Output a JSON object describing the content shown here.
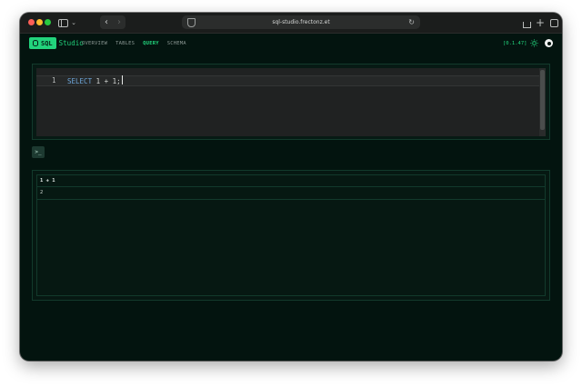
{
  "browser": {
    "url": "sql-studio.frectonz.et"
  },
  "app": {
    "logo_label": "SQL",
    "logo_word": "Studio",
    "nav": [
      {
        "label": "OVERVIEW",
        "active": false
      },
      {
        "label": "TABLES",
        "active": false
      },
      {
        "label": "QUERY",
        "active": true
      },
      {
        "label": "SCHEMA",
        "active": false
      }
    ],
    "version": "[0.1.47]",
    "accent_color": "#22d37c"
  },
  "editor": {
    "line_number": "1",
    "keyword": "SELECT",
    "rest": " 1 + 1;"
  },
  "run_button": {
    "label": ">_"
  },
  "results": {
    "columns": [
      "1 + 1"
    ],
    "rows": [
      [
        "2"
      ]
    ]
  }
}
